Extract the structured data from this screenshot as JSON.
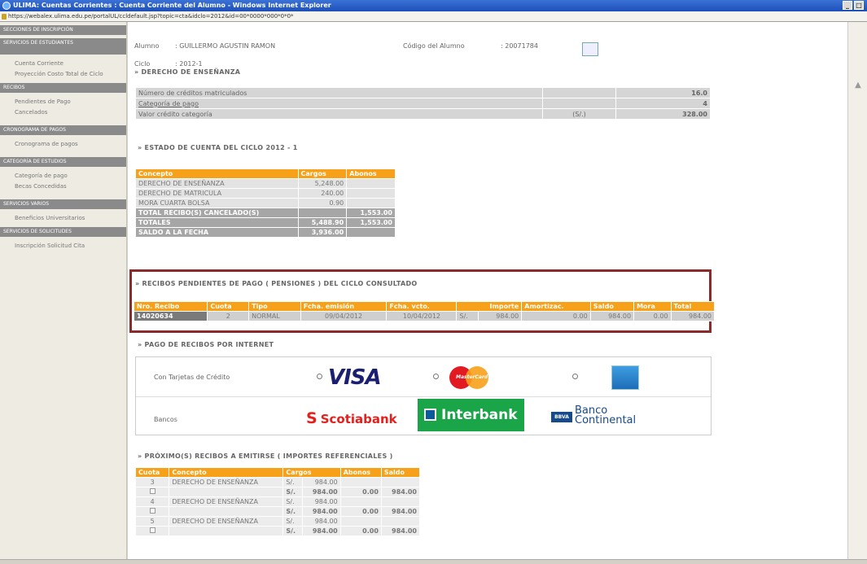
{
  "window": {
    "title": "ULIMA: Cuentas Corrientes : Cuenta Corriente del Alumno - Windows Internet Explorer",
    "url": "https://webalex.ulima.edu.pe/portalUL/ccldefault.jsp?topic=cta&idclo=2012&id=00*0000*000*0*0*"
  },
  "sidebar": {
    "sections": [
      {
        "header": "SECCIONES DE INSCRIPCIÓN",
        "items": []
      },
      {
        "header": "SERVICIOS DE ESTUDIANTES",
        "items": [
          "Cuenta Corriente",
          "Proyección Costo Total de Ciclo"
        ]
      },
      {
        "header": "RECIBOS",
        "items": [
          "Pendientes de Pago",
          "Cancelados"
        ]
      },
      {
        "header": "CRONOGRAMA DE PAGOS",
        "items": [
          "Cronograma de pagos"
        ]
      },
      {
        "header": "CATEGORÍA DE ESTUDIOS",
        "items": [
          "Categoría de pago",
          "Becas Concedidas"
        ]
      },
      {
        "header": "SERVICIOS VARIOS",
        "items": [
          "Beneficios Universitarios"
        ]
      },
      {
        "header": "SERVICIOS DE SOLICITUDES",
        "items": [
          "Inscripción Solicitud Cita"
        ]
      }
    ]
  },
  "header": {
    "alumno_label": "Alumno",
    "alumno_value": ": GUILLERMO AGUSTIN RAMON",
    "codigo_label": "Código del Alumno",
    "codigo_value": ": 20071784",
    "ciclo_label": "Ciclo",
    "ciclo_value": ": 2012-1"
  },
  "ensenanza": {
    "title": "» DERECHO DE ENSEÑANZA",
    "rows": [
      {
        "label": "Número de créditos matriculados",
        "currency": "",
        "value": "16.0"
      },
      {
        "label": "Categoría de pago",
        "currency": "",
        "value": "4"
      },
      {
        "label": "Valor crédito categoría",
        "currency": "(S/.)",
        "value": "328.00"
      }
    ]
  },
  "estado": {
    "title": "» ESTADO DE CUENTA DEL CICLO 2012 - 1",
    "headers": [
      "Concepto",
      "Cargos",
      "Abonos"
    ],
    "rows": [
      {
        "concepto": "DERECHO DE ENSEÑANZA",
        "cargos": "5,248.00",
        "abonos": ""
      },
      {
        "concepto": "DERECHO DE MATRICULA",
        "cargos": "240.00",
        "abonos": ""
      },
      {
        "concepto": "MORA CUARTA BOLSA",
        "cargos": "0.90",
        "abonos": ""
      }
    ],
    "totals": [
      {
        "concepto": "TOTAL RECIBO(S) CANCELADO(S)",
        "cargos": "",
        "abonos": "1,553.00"
      },
      {
        "concepto": "TOTALES",
        "cargos": "5,488.90",
        "abonos": "1,553.00"
      },
      {
        "concepto": "SALDO A LA FECHA",
        "cargos": "3,936.00",
        "abonos": ""
      }
    ]
  },
  "pendientes": {
    "title": "» RECIBOS PENDIENTES DE PAGO ( PENSIONES ) DEL CICLO CONSULTADO",
    "headers": [
      "Nro. Recibo",
      "Cuota",
      "Tipo",
      "Fcha. emisión",
      "Fcha. vcto.",
      "Importe",
      "Amortizac.",
      "Saldo",
      "Mora",
      "Total"
    ],
    "rows": [
      {
        "recibo": "14020634",
        "cuota": "2",
        "tipo": "NORMAL",
        "emision": "09/04/2012",
        "vcto": "10/04/2012",
        "moneda": "S/.",
        "importe": "984.00",
        "amortizac": "0.00",
        "saldo": "984.00",
        "mora": "0.00",
        "total": "984.00"
      }
    ]
  },
  "pago": {
    "title": "» PAGO DE RECIBOS POR INTERNET",
    "tarjetas_label": "Con Tarjetas de Crédito",
    "visa_label": "VISA",
    "mastercard_label": "MasterCard",
    "bancos_label": "Bancos",
    "scotiabank_label": "Scotiabank",
    "interbank_label": "Interbank",
    "bbva_badge": "BBVA",
    "bbva_line1": "Banco",
    "bbva_line2": "Continental"
  },
  "proximos": {
    "title": "» PRÓXIMO(S) RECIBOS A EMITIRSE ( IMPORTES REFERENCIALES )",
    "headers": [
      "Cuota",
      "Concepto",
      "Cargos",
      "Abonos",
      "Saldo"
    ],
    "groups": [
      {
        "cuota": "3",
        "concepto": "DERECHO DE ENSEÑANZA",
        "moneda": "S/.",
        "cargo": "984.00",
        "sub_moneda": "S/.",
        "sub_cargos": "984.00",
        "sub_abonos": "0.00",
        "sub_saldo": "984.00"
      },
      {
        "cuota": "4",
        "concepto": "DERECHO DE ENSEÑANZA",
        "moneda": "S/.",
        "cargo": "984.00",
        "sub_moneda": "S/.",
        "sub_cargos": "984.00",
        "sub_abonos": "0.00",
        "sub_saldo": "984.00"
      },
      {
        "cuota": "5",
        "concepto": "DERECHO DE ENSEÑANZA",
        "moneda": "S/.",
        "cargo": "984.00",
        "sub_moneda": "S/.",
        "sub_cargos": "984.00",
        "sub_abonos": "0.00",
        "sub_saldo": "984.00"
      }
    ]
  },
  "colors": {
    "accent": "#f7a11a",
    "highlight_border": "#8b2a2a",
    "sidebar_header": "#8a8a8a"
  }
}
